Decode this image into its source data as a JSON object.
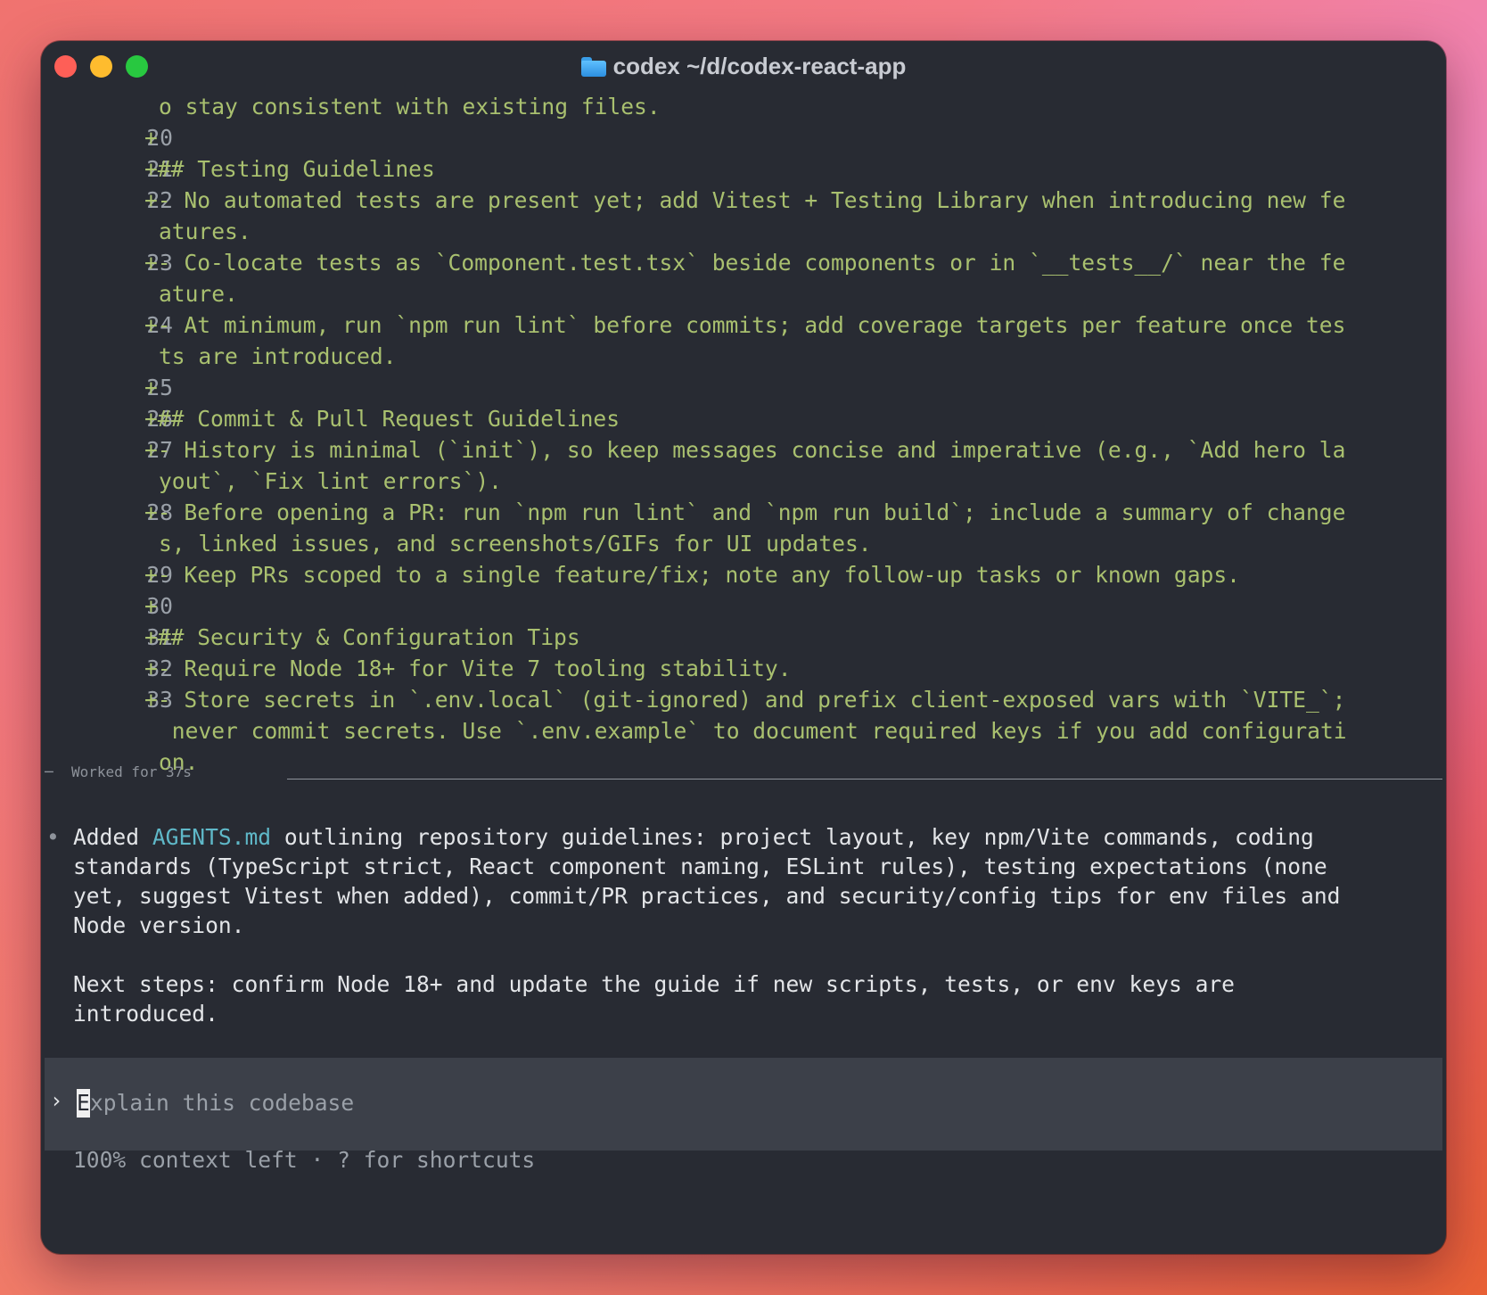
{
  "window": {
    "title": "codex ~/d/codex-react-app"
  },
  "diff": {
    "lines": [
      {
        "num": "",
        "text": "o stay consistent with existing files.",
        "cont": true
      },
      {
        "num": "20",
        "text": "+"
      },
      {
        "num": "21",
        "text": "+## Testing Guidelines"
      },
      {
        "num": "22",
        "text": "+- No automated tests are present yet; add Vitest + Testing Library when introducing new fe"
      },
      {
        "num": "",
        "text": "atures.",
        "cont": true
      },
      {
        "num": "23",
        "text": "+- Co-locate tests as `Component.test.tsx` beside components or in `__tests__/` near the fe"
      },
      {
        "num": "",
        "text": "ature.",
        "cont": true
      },
      {
        "num": "24",
        "text": "+- At minimum, run `npm run lint` before commits; add coverage targets per feature once tes"
      },
      {
        "num": "",
        "text": "ts are introduced.",
        "cont": true
      },
      {
        "num": "25",
        "text": "+"
      },
      {
        "num": "26",
        "text": "+## Commit & Pull Request Guidelines"
      },
      {
        "num": "27",
        "text": "+- History is minimal (`init`), so keep messages concise and imperative (e.g., `Add hero la"
      },
      {
        "num": "",
        "text": "yout`, `Fix lint errors`).",
        "cont": true
      },
      {
        "num": "28",
        "text": "+- Before opening a PR: run `npm run lint` and `npm run build`; include a summary of change"
      },
      {
        "num": "",
        "text": "s, linked issues, and screenshots/GIFs for UI updates.",
        "cont": true
      },
      {
        "num": "29",
        "text": "+- Keep PRs scoped to a single feature/fix; note any follow-up tasks or known gaps."
      },
      {
        "num": "30",
        "text": "+"
      },
      {
        "num": "31",
        "text": "+## Security & Configuration Tips"
      },
      {
        "num": "32",
        "text": "+- Require Node 18+ for Vite 7 tooling stability."
      },
      {
        "num": "33",
        "text": "+- Store secrets in `.env.local` (git-ignored) and prefix client-exposed vars with `VITE_`;"
      },
      {
        "num": "",
        "text": " never commit secrets. Use `.env.example` to document required keys if you add configurati",
        "cont": true
      },
      {
        "num": "",
        "text": "on.",
        "cont": true
      }
    ]
  },
  "worked": {
    "label": "Worked for 37s"
  },
  "summary": {
    "bullet": "•",
    "l1_pre": "Added ",
    "l1_link": "AGENTS.md",
    "l1_post": " outlining repository guidelines: project layout, key npm/Vite commands, coding",
    "l2": "standards (TypeScript strict, React component naming, ESLint rules), testing expectations (none",
    "l3": "yet, suggest Vitest when added), commit/PR practices, and security/config tips for env files and",
    "l4": "Node version.",
    "n1": "Next steps: confirm Node 18+ and update the guide if new scripts, tests, or env keys are",
    "n2": "introduced."
  },
  "input": {
    "prompt": "›",
    "cursor_char": "E",
    "placeholder": "xplain this codebase"
  },
  "footer": {
    "status": "100% context left · ? for shortcuts"
  },
  "colors": {
    "window_bg": "#282b33",
    "diff_text": "#a9c06f",
    "link": "#5fb8c8",
    "input_bg": "#3c4049"
  }
}
